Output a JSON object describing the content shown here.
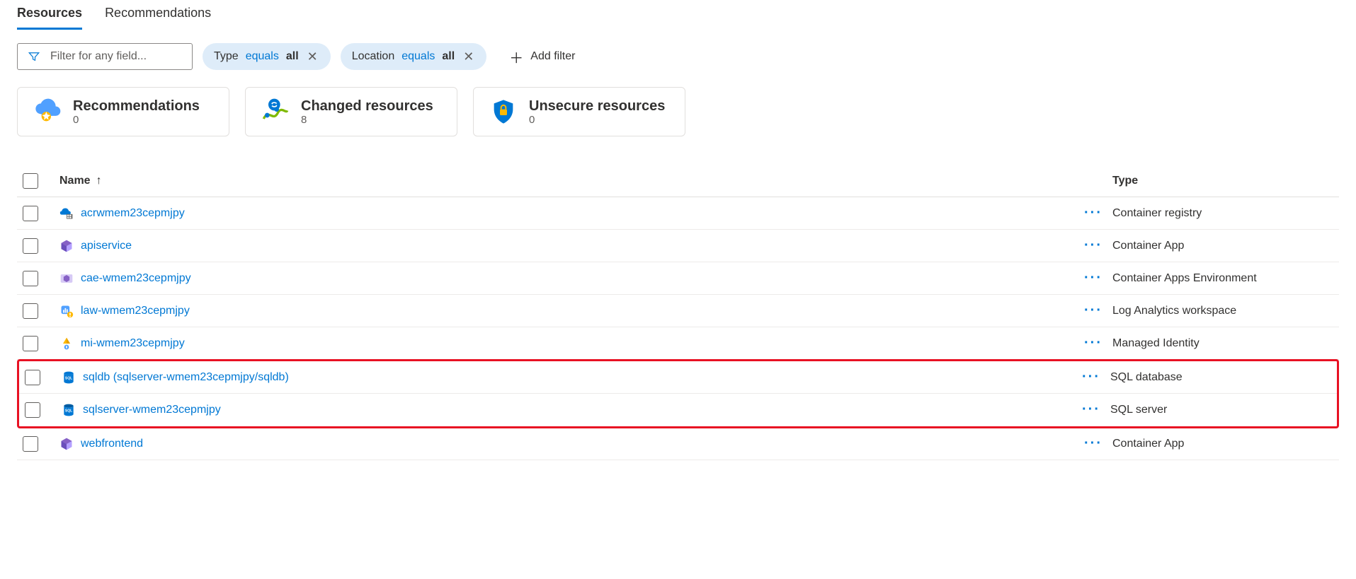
{
  "tabs": {
    "resources": "Resources",
    "recommendations": "Recommendations"
  },
  "filter": {
    "placeholder": "Filter for any field...",
    "type_label": "Type",
    "type_op": "equals",
    "type_val": "all",
    "loc_label": "Location",
    "loc_op": "equals",
    "loc_val": "all",
    "add_filter": "Add filter"
  },
  "cards": {
    "recs_title": "Recommendations",
    "recs_count": "0",
    "changed_title": "Changed resources",
    "changed_count": "8",
    "unsecure_title": "Unsecure resources",
    "unsecure_count": "0"
  },
  "columns": {
    "name": "Name",
    "type": "Type",
    "sort_arrow": "↑"
  },
  "more": "···",
  "rows": [
    {
      "icon": "container-registry",
      "name": "acrwmem23cepmjpy",
      "type": "Container registry",
      "highlight": false
    },
    {
      "icon": "container-app",
      "name": "apiservice",
      "type": "Container App",
      "highlight": false
    },
    {
      "icon": "container-env",
      "name": "cae-wmem23cepmjpy",
      "type": "Container Apps Environment",
      "highlight": false
    },
    {
      "icon": "log-analytics",
      "name": "law-wmem23cepmjpy",
      "type": "Log Analytics workspace",
      "highlight": false
    },
    {
      "icon": "managed-identity",
      "name": "mi-wmem23cepmjpy",
      "type": "Managed Identity",
      "highlight": false
    },
    {
      "icon": "sql-db",
      "name": "sqldb (sqlserver-wmem23cepmjpy/sqldb)",
      "type": "SQL database",
      "highlight": true
    },
    {
      "icon": "sql-server",
      "name": "sqlserver-wmem23cepmjpy",
      "type": "SQL server",
      "highlight": true
    },
    {
      "icon": "container-app",
      "name": "webfrontend",
      "type": "Container App",
      "highlight": false
    }
  ]
}
